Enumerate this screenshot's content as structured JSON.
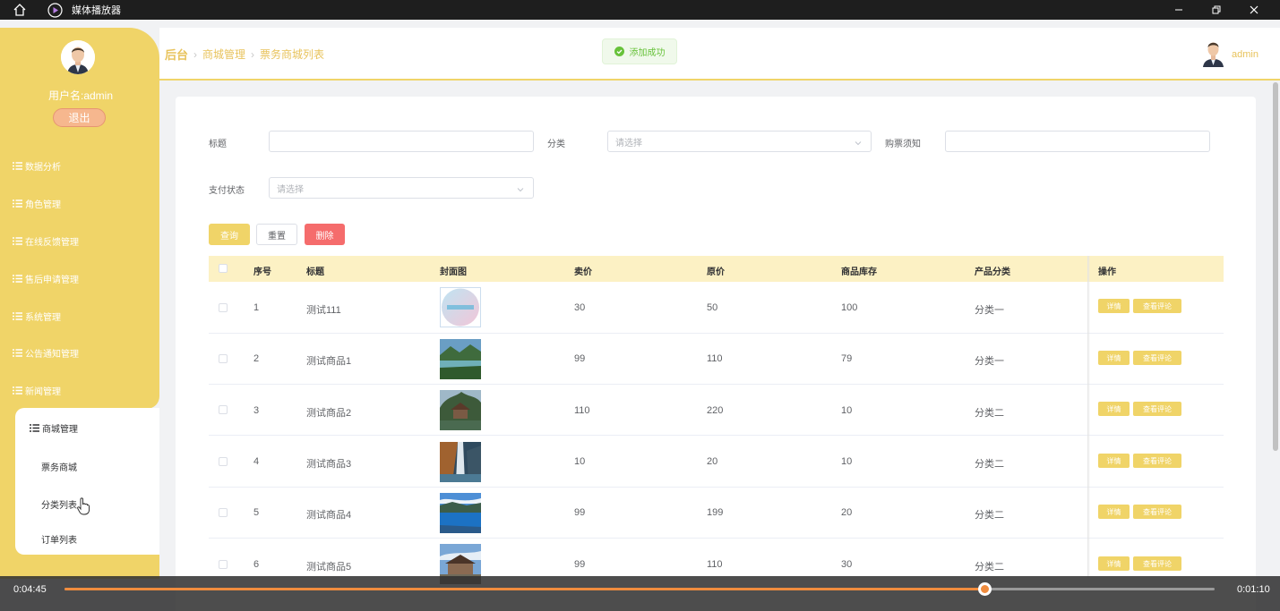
{
  "window": {
    "title": "媒体播放器"
  },
  "sidebar": {
    "username": "用户名:admin",
    "logout": "退出",
    "menu": [
      {
        "label": "数据分析"
      },
      {
        "label": "角色管理"
      },
      {
        "label": "在线反馈管理"
      },
      {
        "label": "售后申请管理"
      },
      {
        "label": "系统管理"
      },
      {
        "label": "公告通知管理"
      },
      {
        "label": "新闻管理"
      }
    ],
    "active_group": {
      "label": "商城管理",
      "items": [
        {
          "label": "票务商城"
        },
        {
          "label": "分类列表"
        },
        {
          "label": "订单列表"
        }
      ]
    }
  },
  "header": {
    "breadcrumb": [
      "后台",
      "商城管理",
      "票务商城列表"
    ],
    "toast": "添加成功",
    "admin_name": "admin"
  },
  "filters": {
    "title_label": "标题",
    "title_value": "",
    "category_label": "分类",
    "category_placeholder": "请选择",
    "notice_label": "购票须知",
    "notice_value": "",
    "pay_status_label": "支付状态",
    "pay_status_placeholder": "请选择"
  },
  "actions": {
    "query": "查询",
    "reset": "重置",
    "delete": "删除"
  },
  "table": {
    "columns": [
      "序号",
      "标题",
      "封面图",
      "卖价",
      "原价",
      "商品库存",
      "产品分类",
      "操作"
    ],
    "row_actions": {
      "detail": "详情",
      "comments": "查看评论"
    },
    "rows": [
      {
        "no": "1",
        "title": "测试111",
        "cover": "gradient-circle",
        "price": "30",
        "original": "50",
        "stock": "100",
        "category": "分类一"
      },
      {
        "no": "2",
        "title": "测试商品1",
        "cover": "lake-landscape",
        "price": "99",
        "original": "110",
        "stock": "79",
        "category": "分类一"
      },
      {
        "no": "3",
        "title": "测试商品2",
        "cover": "pavilion-landscape",
        "price": "110",
        "original": "220",
        "stock": "10",
        "category": "分类二"
      },
      {
        "no": "4",
        "title": "测试商品3",
        "cover": "waterfall-landscape",
        "price": "10",
        "original": "20",
        "stock": "10",
        "category": "分类二"
      },
      {
        "no": "5",
        "title": "测试商品4",
        "cover": "blue-lake-landscape",
        "price": "99",
        "original": "199",
        "stock": "20",
        "category": "分类二"
      },
      {
        "no": "6",
        "title": "测试商品5",
        "cover": "temple-landscape",
        "price": "99",
        "original": "110",
        "stock": "30",
        "category": "分类二"
      }
    ]
  },
  "player": {
    "elapsed": "0:04:45",
    "remaining": "0:01:10",
    "progress": 0.8
  },
  "colors": {
    "accent": "#f0d468",
    "danger": "#f56c6c",
    "success": "#67c23a",
    "progress": "#f08c3e"
  }
}
